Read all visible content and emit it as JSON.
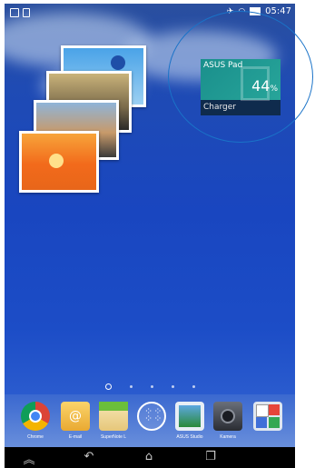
{
  "status_bar": {
    "time": "05:47",
    "left_icons": [
      "window-icon",
      "document-icon"
    ],
    "right_icons": [
      "signal-icon",
      "wifi-icon",
      "battery-icon"
    ]
  },
  "widget": {
    "title": "ASUS Pad",
    "percent": "44",
    "percent_unit": "%",
    "label": "Charger",
    "level": 0.44,
    "colors": {
      "top": "#27a59a",
      "bottom": "#0f2b4d"
    }
  },
  "dock": {
    "apps": [
      {
        "label": "Chrome",
        "icon": "chrome-icon"
      },
      {
        "label": "E-mail",
        "icon": "email-icon"
      },
      {
        "label": "SuperNote L",
        "icon": "supernote-icon"
      },
      {
        "label": "",
        "icon": "app-drawer-icon"
      },
      {
        "label": "ASUS Studio",
        "icon": "studio-icon"
      },
      {
        "label": "Kamera",
        "icon": "camera-icon"
      },
      {
        "label": "",
        "icon": "play-store-folder-icon"
      }
    ]
  },
  "nav": {
    "buttons": [
      "up-icon",
      "back-icon",
      "home-icon",
      "recents-icon"
    ]
  },
  "colors": {
    "accent_circle": "#1a73c8",
    "wallpaper": "#1946c0"
  }
}
